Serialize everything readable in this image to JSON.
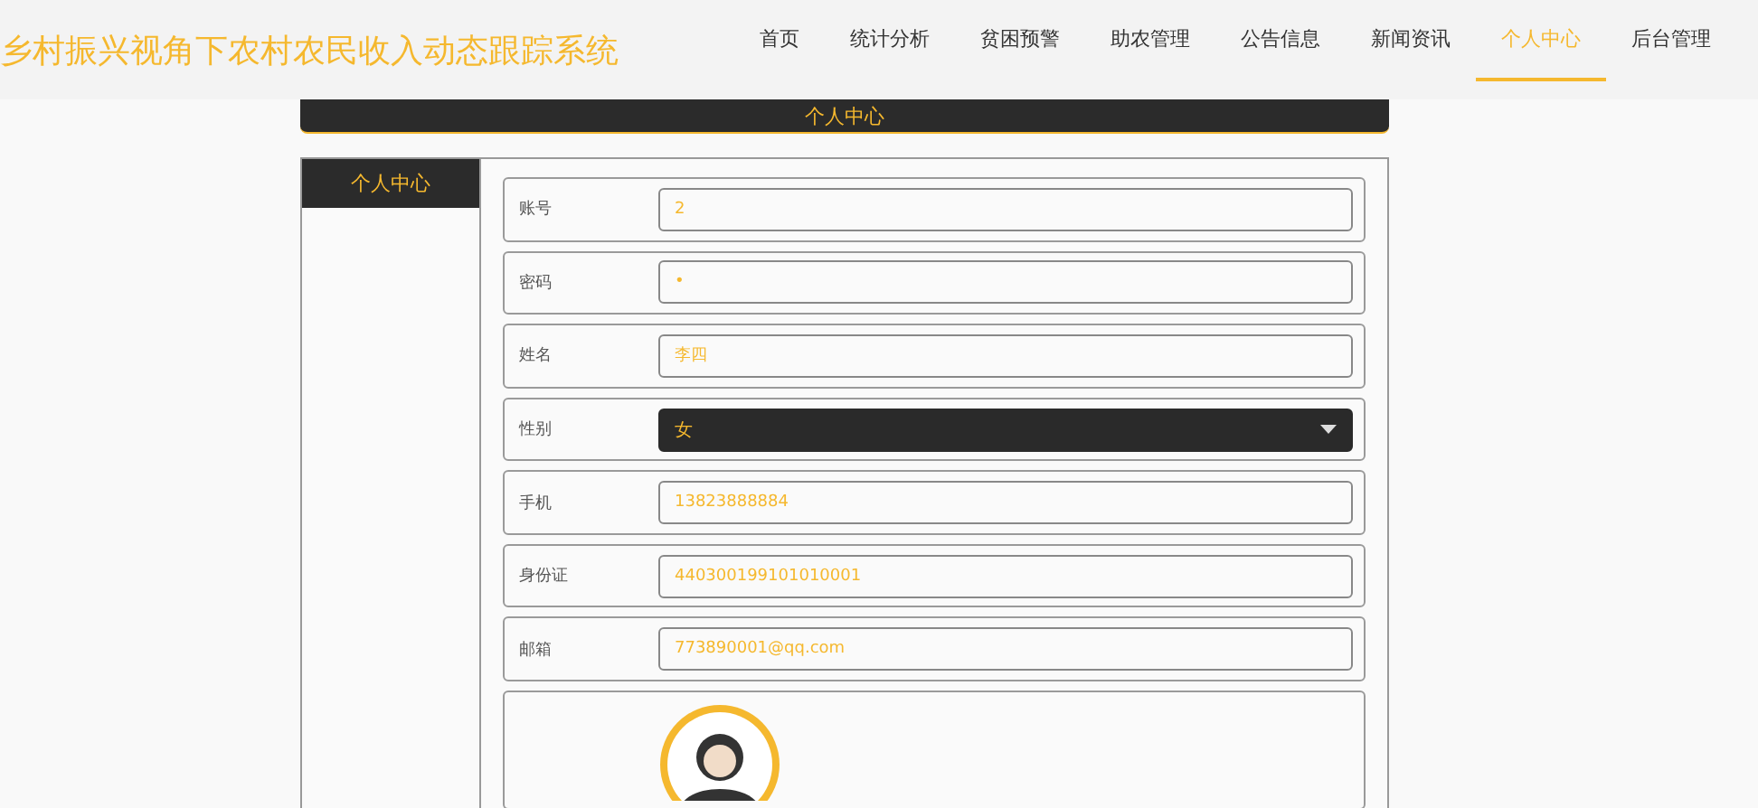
{
  "site_title": "乡村振兴视角下农村农民收入动态跟踪系统",
  "nav": [
    {
      "label": "首页",
      "selected": false
    },
    {
      "label": "统计分析",
      "selected": false
    },
    {
      "label": "贫困预警",
      "selected": false
    },
    {
      "label": "助农管理",
      "selected": false
    },
    {
      "label": "公告信息",
      "selected": false
    },
    {
      "label": "新闻资讯",
      "selected": false
    },
    {
      "label": "个人中心",
      "selected": true
    },
    {
      "label": "后台管理",
      "selected": false
    }
  ],
  "page_title": "个人中心",
  "sidebar": {
    "items": [
      {
        "label": "个人中心",
        "selected": true
      }
    ]
  },
  "form": {
    "fields": [
      {
        "kind": "text",
        "label": "账号",
        "value": "2"
      },
      {
        "kind": "text",
        "label": "密码",
        "value": "•"
      },
      {
        "kind": "text",
        "label": "姓名",
        "value": "李四"
      },
      {
        "kind": "select",
        "label": "性别",
        "value": "女"
      },
      {
        "kind": "text",
        "label": "手机",
        "value": "13823888884"
      },
      {
        "kind": "text",
        "label": "身份证",
        "value": "440300199101010001"
      },
      {
        "kind": "text",
        "label": "邮箱",
        "value": "773890001@qq.com"
      },
      {
        "kind": "picture"
      }
    ]
  }
}
